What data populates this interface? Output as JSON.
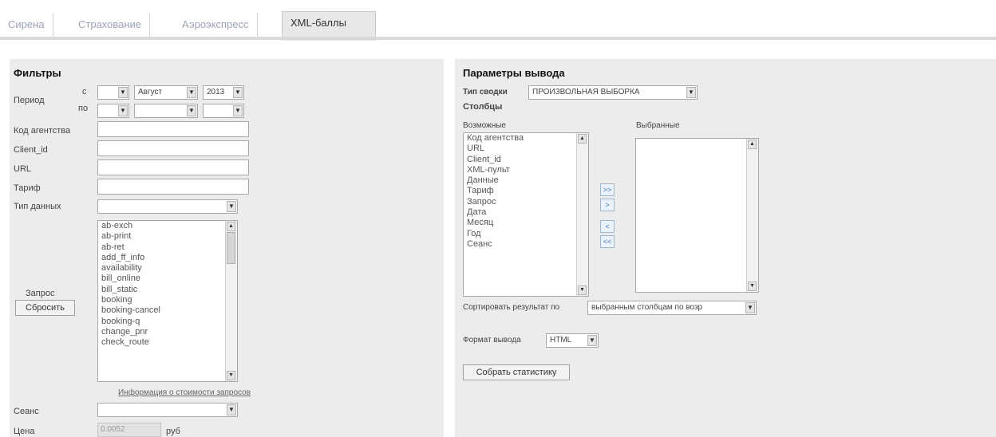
{
  "tabs": [
    "Сирена",
    "Страхование",
    "Аэроэкспресс",
    "XML-баллы"
  ],
  "filters": {
    "title": "Фильтры",
    "period_label": "Период",
    "from_label": "с",
    "to_label": "по",
    "from_day": "",
    "from_month": "Август",
    "from_year": "2013",
    "to_day": "",
    "to_month": "",
    "to_year": "",
    "agency_code_label": "Код агентства",
    "client_id_label": "Client_id",
    "url_label": "URL",
    "tariff_label": "Тариф",
    "data_type_label": "Тип данных",
    "data_type_value": "",
    "request_label": "Запрос",
    "reset_button": "Сбросить",
    "request_items": [
      "ab-exch",
      "ab-print",
      "ab-ret",
      "add_ff_info",
      "availability",
      "bill_online",
      "bill_static",
      "booking",
      "booking-cancel",
      "booking-q",
      "change_pnr",
      "check_route"
    ],
    "request_cost_link": "Информация о стоимости запросов",
    "session_label": "Сеанс",
    "session_value": "",
    "price_label": "Цена",
    "price_value": "0.0052",
    "price_unit": "руб"
  },
  "output": {
    "title": "Параметры вывода",
    "summary_type_label": "Тип сводки",
    "summary_type_value": "ПРОИЗВОЛЬНАЯ ВЫБОРКА",
    "columns_label": "Столбцы",
    "available_label": "Возможные",
    "selected_label": "Выбранные",
    "available_items": [
      "Код агентства",
      "URL",
      "Client_id",
      "XML-пульт",
      "Данные",
      "Тариф",
      "Запрос",
      "Дата",
      "Месяц",
      "Год",
      "Сеанс"
    ],
    "selected_items": [],
    "move_buttons": [
      ">>",
      ">",
      "<",
      "<<"
    ],
    "sort_label": "Сортировать результат по",
    "sort_value": "выбранным столбцам по возр",
    "format_label": "Формат вывода",
    "format_value": "HTML",
    "collect_button": "Собрать статистику"
  }
}
